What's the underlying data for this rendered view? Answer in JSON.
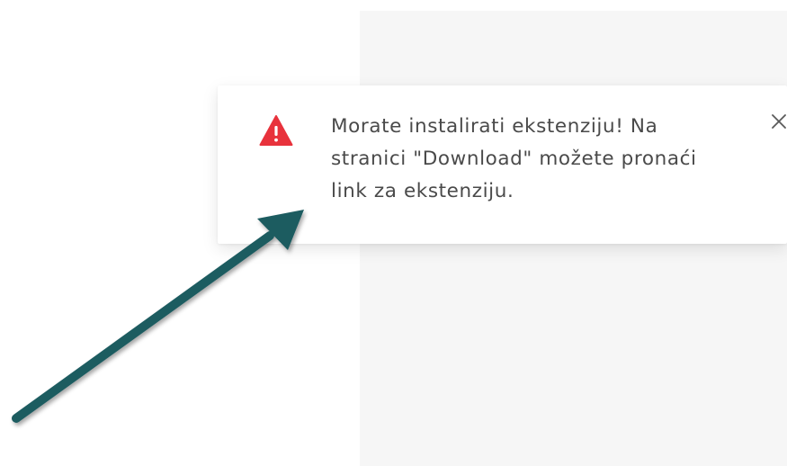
{
  "toast": {
    "icon": "warning-triangle-icon",
    "message": "Morate instalirati ekstenziju! Na\nstranici \"Download\" možete pronaći\nlink za ekstenziju.",
    "close_icon": "close-icon"
  },
  "annotation": {
    "icon": "arrow-icon",
    "color": "#1f5b61"
  },
  "colors": {
    "warning": "#e8323c",
    "text": "#4a4a4a",
    "panel_background": "#f6f6f6"
  }
}
